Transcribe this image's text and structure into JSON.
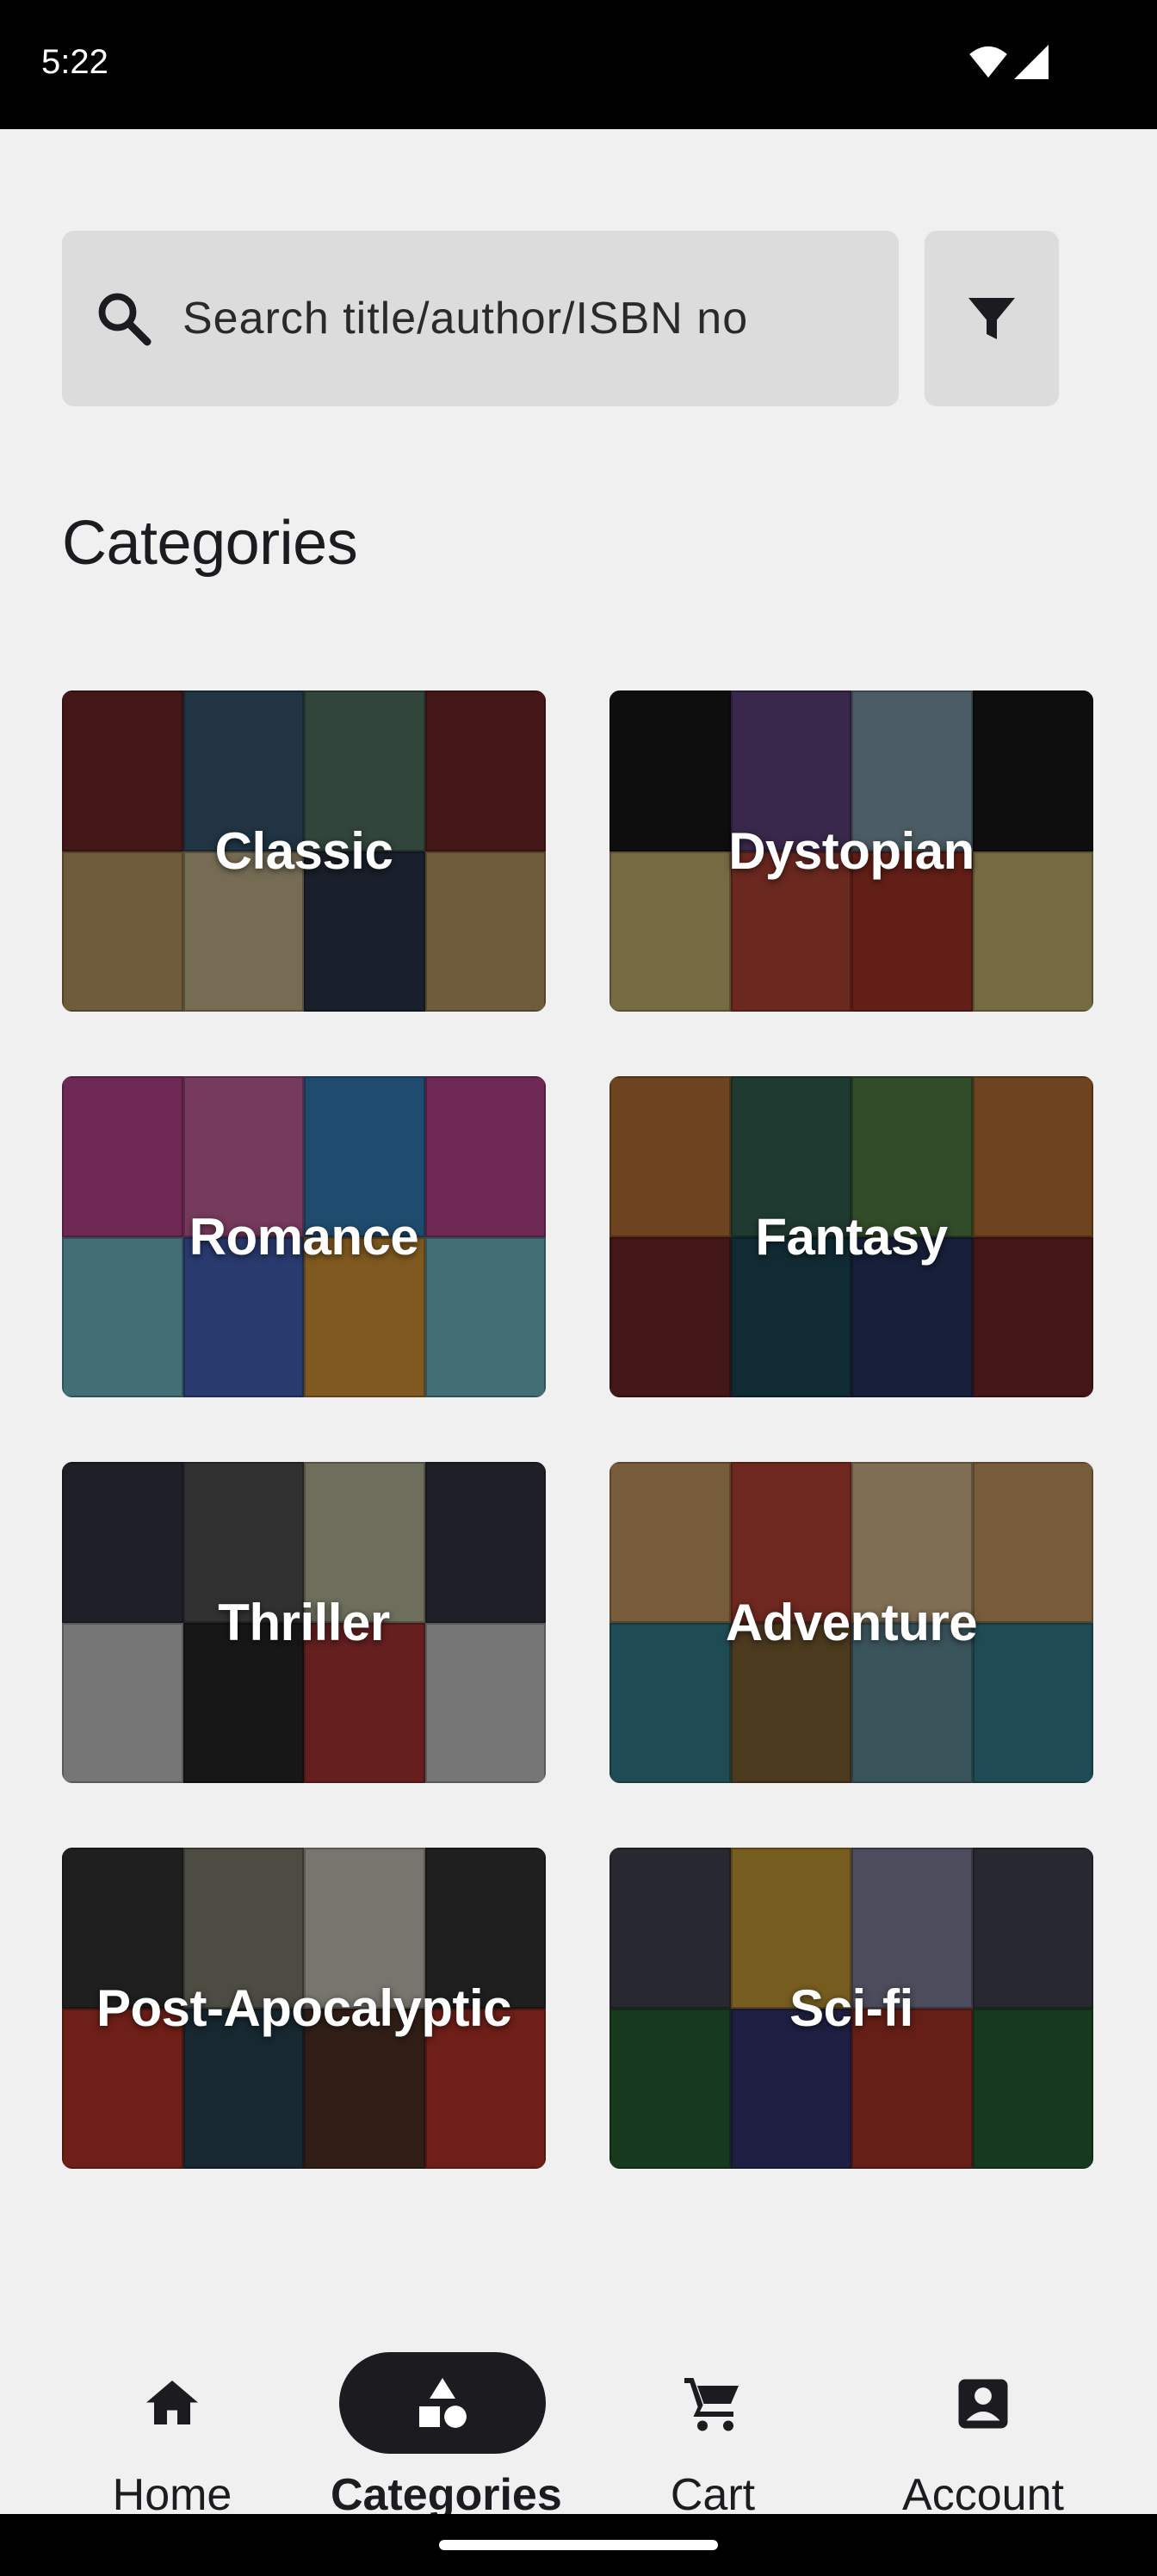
{
  "status_bar": {
    "time": "5:22"
  },
  "search": {
    "placeholder": "Search title/author/ISBN no"
  },
  "section_title": "Categories",
  "categories": [
    {
      "label": "Classic",
      "palette": [
        "#7a2a2a",
        "#c9a86a",
        "#3b5f7a",
        "#d7c59a",
        "#5a7f6a",
        "#2e3a4f"
      ]
    },
    {
      "label": "Dystopian",
      "palette": [
        "#b23a2a",
        "#1a1a1a",
        "#d8c27a",
        "#6a4a8a",
        "#c24a3a",
        "#8aa8b8"
      ]
    },
    {
      "label": "Romance",
      "palette": [
        "#3a8ac8",
        "#e8a23a",
        "#c84a9a",
        "#7ac8d8",
        "#d86aa8",
        "#4a6ac8"
      ]
    },
    {
      "label": "Fantasy",
      "palette": [
        "#1f4f5f",
        "#5a8a4a",
        "#2a3a6a",
        "#c87a3a",
        "#7a2a2a",
        "#3a6a5a"
      ]
    },
    {
      "label": "Thriller",
      "palette": [
        "#5a5a5a",
        "#2a2a2a",
        "#c8c8a8",
        "#b83a3a",
        "#3a3a4a",
        "#d8d8d8"
      ]
    },
    {
      "label": "Adventure",
      "palette": [
        "#3a8a9a",
        "#c84a3a",
        "#8a6a3a",
        "#e8c89a",
        "#6a9aa8",
        "#d8a86a"
      ]
    },
    {
      "label": "Post-Apocalyptic",
      "palette": [
        "#3a3a3a",
        "#c83a2a",
        "#8a8a7a",
        "#2a4a5a",
        "#d8d8c8",
        "#5a3a2a"
      ]
    },
    {
      "label": "Sci-fi",
      "palette": [
        "#b83a2a",
        "#4a4a5a",
        "#2a6a3a",
        "#d8a83a",
        "#3a3a7a",
        "#8a8aa8"
      ]
    }
  ],
  "nav": [
    {
      "label": "Home",
      "icon": "home-icon",
      "active": false
    },
    {
      "label": "Categories",
      "icon": "categories-icon",
      "active": true
    },
    {
      "label": "Cart",
      "icon": "cart-icon",
      "active": false
    },
    {
      "label": "Account",
      "icon": "account-icon",
      "active": false
    }
  ]
}
